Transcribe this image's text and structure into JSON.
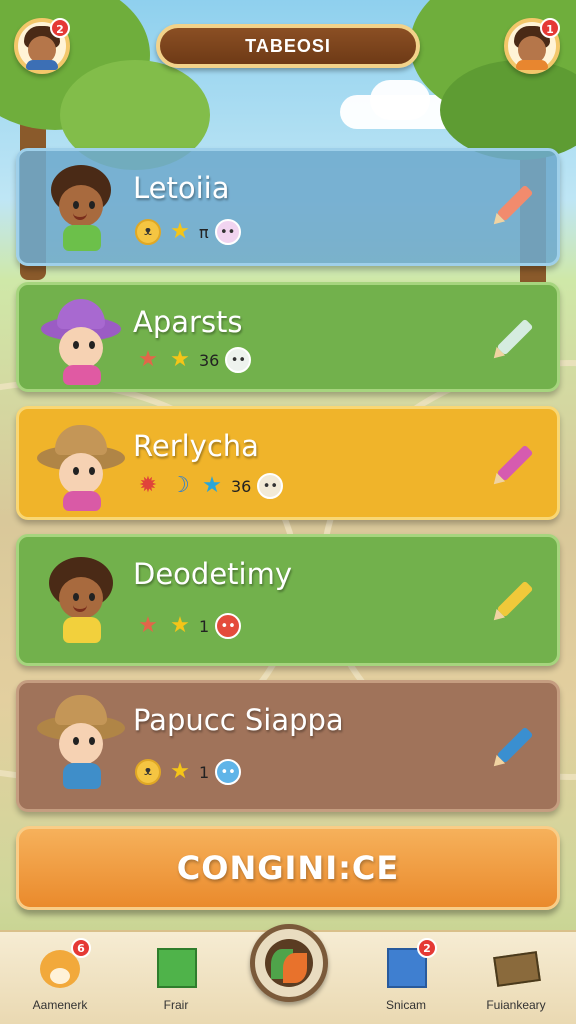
{
  "header": {
    "title": "TABEOSI",
    "left_avatar_badge": "2",
    "right_avatar_badge": "1"
  },
  "players": [
    {
      "name": "Letoiia",
      "stat_value": "π",
      "theme": "#6aa6c9"
    },
    {
      "name": "Aparsts",
      "stat_value": "36",
      "theme": "#72b14c"
    },
    {
      "name": "Rerlycha",
      "stat_value": "36",
      "theme": "#f0b42a"
    },
    {
      "name": "Deodetimy",
      "stat_value": "1",
      "theme": "#72b14c"
    },
    {
      "name": "Papucc Siappa",
      "stat_value": "1",
      "theme": "#a0735a"
    }
  ],
  "continue_label": "CONGINI:CE",
  "nav": {
    "items": [
      {
        "label": "Aamenerk",
        "badge": "6"
      },
      {
        "label": "Frair",
        "badge": ""
      },
      {
        "label": "Snicam",
        "badge": "2"
      },
      {
        "label": "Fuiankeary",
        "badge": ""
      }
    ]
  }
}
